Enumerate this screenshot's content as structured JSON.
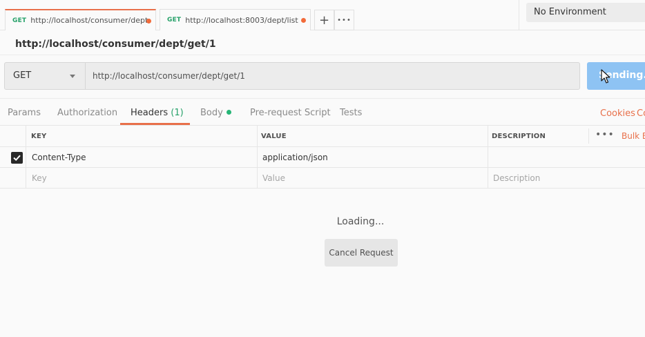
{
  "tabs": [
    {
      "method": "GET",
      "url": "http://localhost/consumer/dept/",
      "active": true,
      "unsaved": true
    },
    {
      "method": "GET",
      "url": "http://localhost:8003/dept/list",
      "active": false,
      "unsaved": true
    }
  ],
  "tab_actions": {
    "new_tab_icon": "plus-icon",
    "more_icon": "ellipsis-icon",
    "new_tab_glyph": "+",
    "more_glyph": "•••"
  },
  "environment": {
    "selected": "No Environment"
  },
  "request": {
    "title": "http://localhost/consumer/dept/get/1",
    "method": "GET",
    "url": "http://localhost/consumer/dept/get/1",
    "send_label": "Sending..."
  },
  "subtabs": {
    "params": "Params",
    "authorization": "Authorization",
    "headers": "Headers",
    "headers_count": "(1)",
    "body": "Body",
    "prerequest": "Pre-request Script",
    "tests": "Tests",
    "cookies": "Cookies",
    "code": "Co"
  },
  "headers_table": {
    "columns": {
      "key": "KEY",
      "value": "VALUE",
      "description": "DESCRIPTION"
    },
    "more_glyph": "•••",
    "bulk_edit": "Bulk E",
    "rows": [
      {
        "checked": true,
        "key": "Content-Type",
        "value": "application/json",
        "description": ""
      }
    ],
    "placeholders": {
      "key": "Key",
      "value": "Value",
      "description": "Description"
    }
  },
  "response": {
    "loading_text": "Loading...",
    "cancel_label": "Cancel Request"
  },
  "colors": {
    "accent": "#e8704a",
    "method_green": "#26a169",
    "send_blue": "#8ec3f3"
  }
}
